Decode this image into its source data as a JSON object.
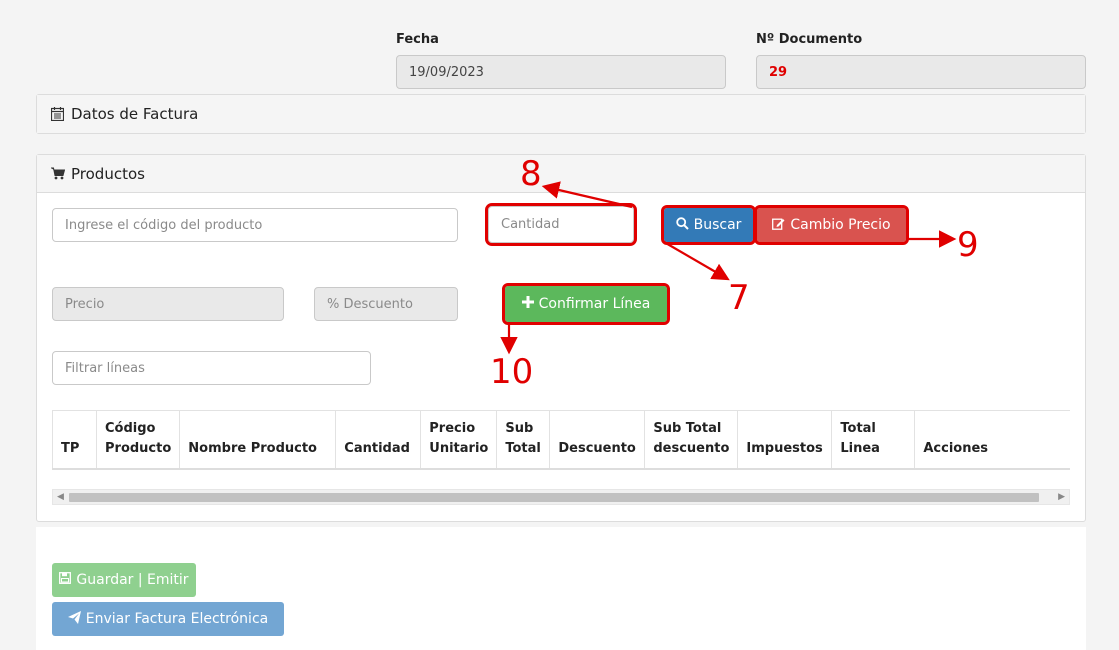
{
  "header": {
    "fecha_label": "Fecha",
    "fecha_value": "19/09/2023",
    "documento_label": "Nº Documento",
    "documento_value": "29"
  },
  "datos_panel": {
    "title": "Datos de Factura",
    "icon": "calendar-icon"
  },
  "productos_panel": {
    "title": "Productos",
    "icon": "cart-icon",
    "codigo_placeholder": "Ingrese el código del producto",
    "cantidad_placeholder": "Cantidad",
    "buscar_label": "Buscar",
    "cambio_precio_label": "Cambio Precio",
    "precio_placeholder": "Precio",
    "descuento_placeholder": "% Descuento",
    "confirmar_label": "Confirmar Línea",
    "filtrar_placeholder": "Filtrar líneas"
  },
  "table": {
    "columns": [
      "TP",
      "Código Producto",
      "Nombre Producto",
      "Cantidad",
      "Precio Unitario",
      "Sub Total",
      "Descuento",
      "Sub Total descuento",
      "Impuestos",
      "Total Linea",
      "Acciones"
    ]
  },
  "footer": {
    "guardar_label": "Guardar | Emitir",
    "enviar_label": "Enviar Factura Electrónica"
  },
  "annotations": {
    "n7": "7",
    "n8": "8",
    "n9": "9",
    "n10": "10",
    "color": "#e00000"
  }
}
